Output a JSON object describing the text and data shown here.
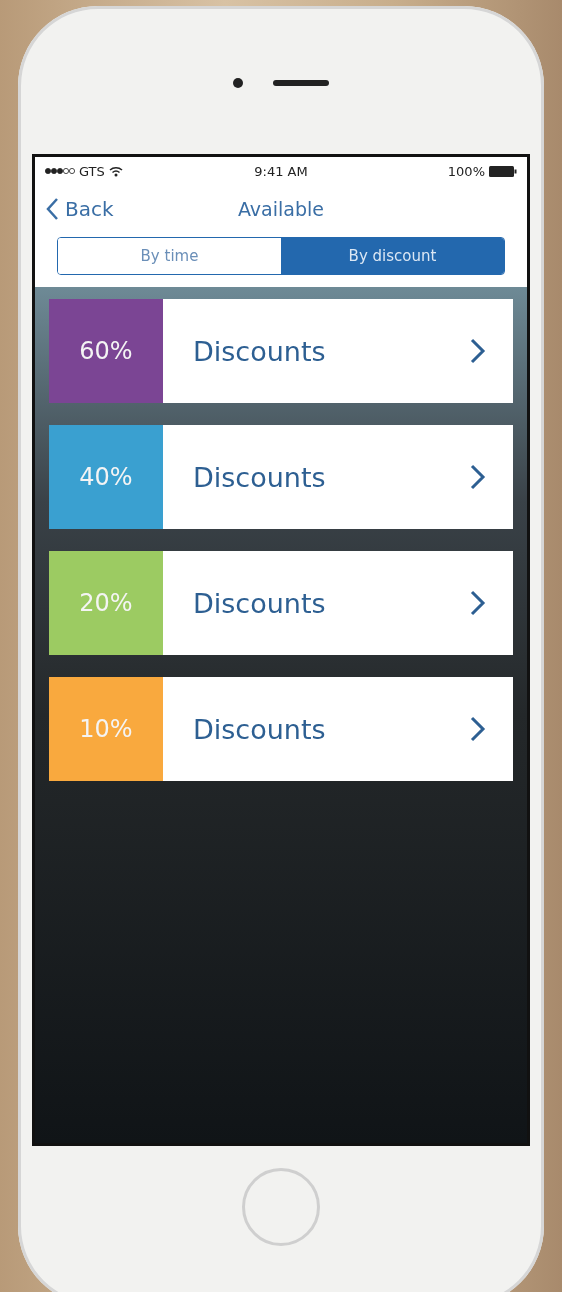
{
  "status_bar": {
    "carrier": "GTS",
    "time": "9:41 AM",
    "battery": "100%"
  },
  "nav": {
    "back": "Back",
    "title": "Available"
  },
  "segments": [
    {
      "label": "By time",
      "selected": false
    },
    {
      "label": "By discount",
      "selected": true
    }
  ],
  "items": [
    {
      "percent": "60%",
      "label": "Discounts",
      "color": "#7b4594"
    },
    {
      "percent": "40%",
      "label": "Discounts",
      "color": "#3aa0d0"
    },
    {
      "percent": "20%",
      "label": "Discounts",
      "color": "#9ccb62"
    },
    {
      "percent": "10%",
      "label": "Discounts",
      "color": "#f9a93e"
    }
  ]
}
